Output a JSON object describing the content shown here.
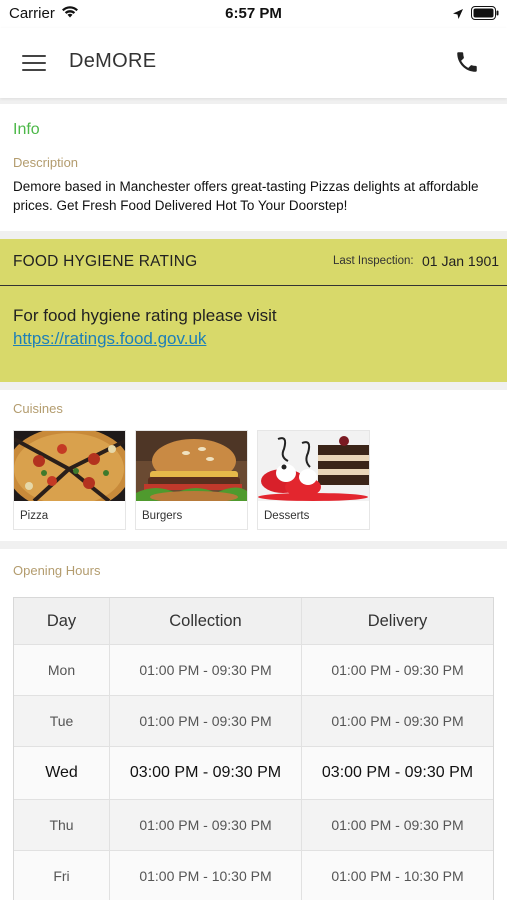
{
  "status_bar": {
    "carrier": "Carrier",
    "time": "6:57 PM",
    "icons": [
      "wifi-icon",
      "location-arrow-icon",
      "battery-icon"
    ]
  },
  "nav": {
    "title": "DeMORE",
    "icons": [
      "hamburger-menu-icon",
      "phone-icon"
    ]
  },
  "info": {
    "heading": "Info",
    "description_label": "Description",
    "description": "Demore based in Manchester offers great-tasting Pizzas delights at affordable prices. Get Fresh Food Delivered Hot To Your Doorstep!"
  },
  "hygiene": {
    "title": "FOOD HYGIENE RATING",
    "last_inspection_label": "Last Inspection:",
    "last_inspection_value": "01 Jan 1901",
    "text": "For food hygiene rating please visit",
    "link": "https://ratings.food.gov.uk",
    "background": "#d8d96a"
  },
  "cuisines": {
    "label": "Cuisines",
    "items": [
      {
        "name": "Pizza"
      },
      {
        "name": "Burgers"
      },
      {
        "name": "Desserts"
      }
    ]
  },
  "opening_hours": {
    "label": "Opening Hours",
    "headers": [
      "Day",
      "Collection",
      "Delivery"
    ],
    "rows": [
      {
        "day": "Mon",
        "collection": "01:00 PM - 09:30 PM",
        "delivery": "01:00 PM - 09:30 PM"
      },
      {
        "day": "Tue",
        "collection": "01:00 PM - 09:30 PM",
        "delivery": "01:00 PM - 09:30 PM"
      },
      {
        "day": "Wed",
        "collection": "03:00 PM - 09:30 PM",
        "delivery": "03:00 PM - 09:30 PM"
      },
      {
        "day": "Thu",
        "collection": "01:00 PM - 09:30 PM",
        "delivery": "01:00 PM - 09:30 PM"
      },
      {
        "day": "Fri",
        "collection": "01:00 PM - 10:30 PM",
        "delivery": "01:00 PM - 10:30 PM"
      }
    ]
  },
  "colors": {
    "accent_green": "#4cb848",
    "label_tan": "#b39c6e",
    "link_blue": "#1d7fb8"
  }
}
